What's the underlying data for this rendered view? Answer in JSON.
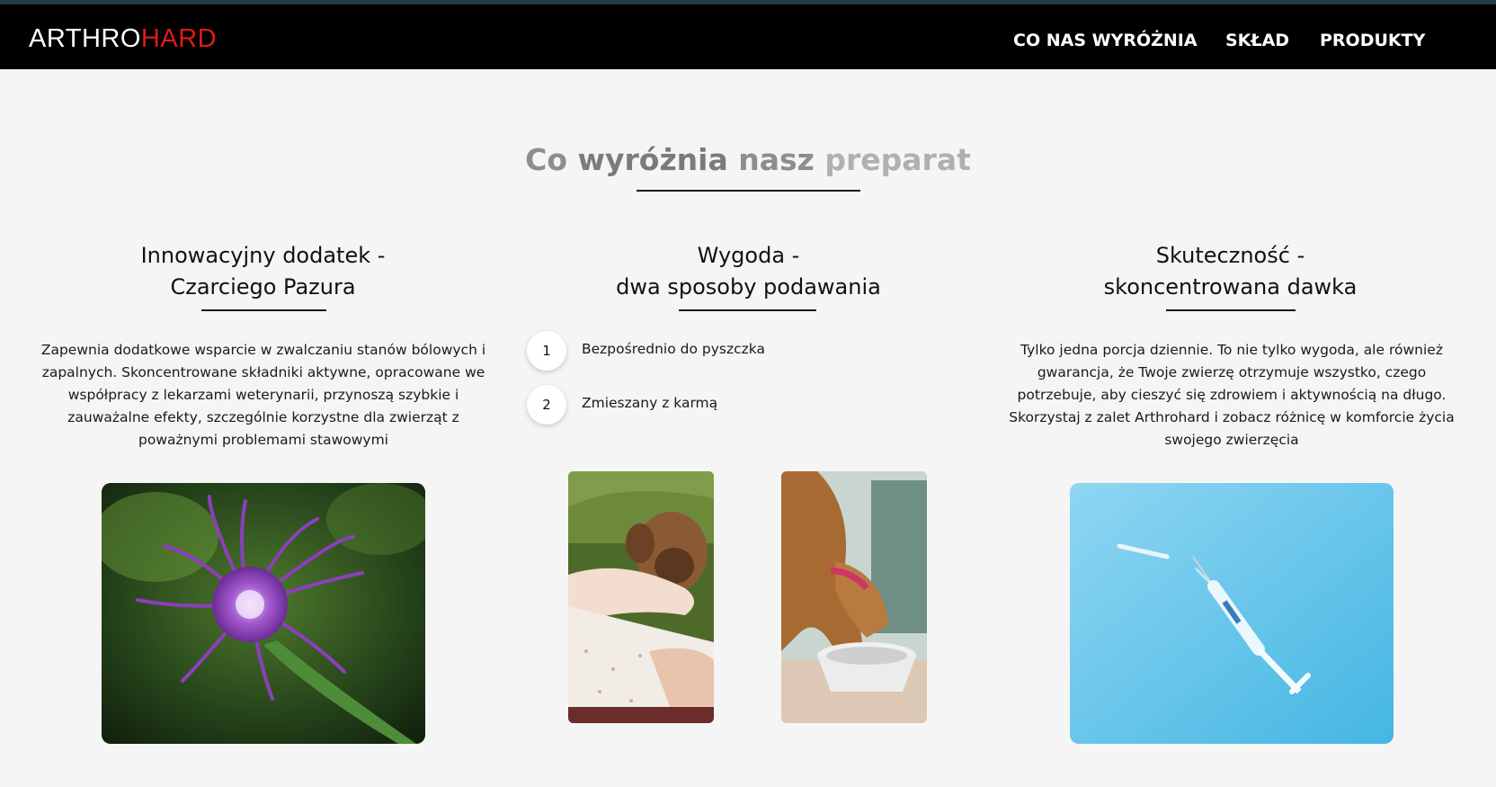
{
  "brand": {
    "part1": "ARTHRO",
    "part2": "HARD"
  },
  "nav": [
    "CO NAS WYRÓŻNIA",
    "SKŁAD",
    "PRODUKTY"
  ],
  "section": {
    "title_words": [
      "Co",
      "wyróżnia",
      "nasz",
      "preparat"
    ]
  },
  "features": [
    {
      "title_line1": "Innowacyjny dodatek -",
      "title_line2": "Czarciego Pazura",
      "text": "Zapewnia dodatkowe wsparcie w zwalczaniu stanów bólowych i zapalnych. Skoncentrowane składniki aktywne, opracowane we współpracy z lekarzami weterynarii, przynoszą szybkie i zauważalne efekty, szczególnie korzystne dla zwierząt z poważnymi problemami stawowymi"
    },
    {
      "title_line1": "Wygoda -",
      "title_line2": "dwa sposoby podawania",
      "steps": [
        {
          "number": "1",
          "label": "Bezpośrednio do pyszczka"
        },
        {
          "number": "2",
          "label": "Zmieszany z karmą"
        }
      ]
    },
    {
      "title_line1": "Skuteczność -",
      "title_line2": "skoncentrowana dawka",
      "text": "Tylko jedna porcja dziennie. To nie tylko wygoda, ale również gwarancja, że Twoje zwierzę otrzymuje wszystko, czego potrzebuje, aby cieszyć się zdrowiem i aktywnością na długo. Skorzystaj z zalet Arthrohard i zobacz różnicę w komforcie życia swojego zwierzęcia"
    }
  ],
  "colors": {
    "navbar": "#000000",
    "brand_accent": "#e01a1a",
    "background": "#f5f5f5",
    "syringe_bg": "#5fc4ea"
  }
}
